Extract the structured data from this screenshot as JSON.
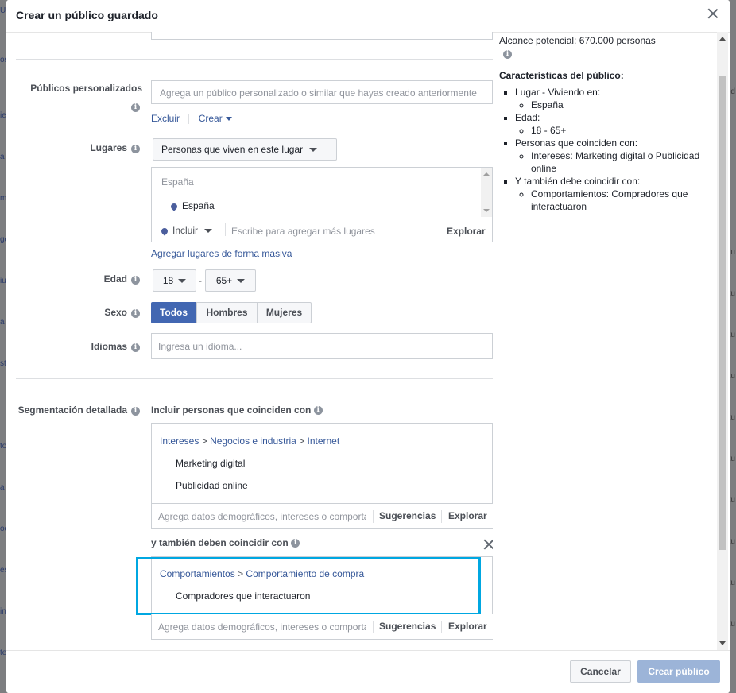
{
  "background": {
    "left_fragments": [
      "U",
      "os",
      "ie",
      "a",
      "mi",
      "go",
      "iu",
      "a",
      "st",
      "to",
      "a",
      "oc",
      "es",
      "in",
      "te"
    ],
    "right_fragments": [
      "id",
      "tu",
      "tu",
      "tu",
      "tu",
      "tu",
      "tu",
      "tu",
      "tu",
      "tu",
      "tu"
    ]
  },
  "dialog": {
    "title": "Crear un público guardado"
  },
  "form": {
    "custom_audiences": {
      "label": "Públicos personalizados",
      "placeholder": "Agrega un público personalizado o similar que hayas creado anteriormente",
      "exclude": "Excluir",
      "create": "Crear"
    },
    "locations": {
      "label": "Lugares",
      "dropdown": "Personas que viven en este lugar",
      "country_header": "España",
      "selected": "España",
      "include": "Incluir",
      "search_placeholder": "Escribe para agregar más lugares",
      "explore": "Explorar",
      "bulk_link": "Agregar lugares de forma masiva"
    },
    "age": {
      "label": "Edad",
      "min": "18",
      "separator": "-",
      "max": "65+"
    },
    "gender": {
      "label": "Sexo",
      "options": [
        "Todos",
        "Hombres",
        "Mujeres"
      ],
      "selected": "Todos"
    },
    "languages": {
      "label": "Idiomas",
      "placeholder": "Ingresa un idioma..."
    },
    "detailed": {
      "label": "Segmentación detallada",
      "include_label": "Incluir personas que coinciden con",
      "include_breadcrumb": [
        "Intereses",
        "Negocios e industria",
        "Internet"
      ],
      "include_items": [
        "Marketing digital",
        "Publicidad online"
      ],
      "search_placeholder": "Agrega datos demográficos, intereses o comporta",
      "suggestions": "Sugerencias",
      "explore": "Explorar",
      "narrow_label": "y también deben coincidir con",
      "narrow_breadcrumb": [
        "Comportamientos",
        "Comportamiento de compra"
      ],
      "narrow_items": [
        "Compradores que interactuaron"
      ],
      "breadcrumb_sep": ">"
    }
  },
  "summary": {
    "reach": "Alcance potencial: 670.000 personas",
    "title": "Características del público:",
    "location": "Lugar - Viviendo en:",
    "location_value": "España",
    "age": "Edad:",
    "age_value": "18 - 65+",
    "interests": "Personas que coinciden con:",
    "interests_value": "Intereses: Marketing digital o Publicidad online",
    "narrow": "Y también debe coincidir con:",
    "narrow_value": "Comportamientos: Compradores que interactuaron"
  },
  "footer": {
    "cancel": "Cancelar",
    "create": "Crear público"
  },
  "colors": {
    "primary": "#4267b2",
    "primary_disabled": "#9cb4d8",
    "link": "#365899",
    "highlight": "#00a7e1"
  }
}
